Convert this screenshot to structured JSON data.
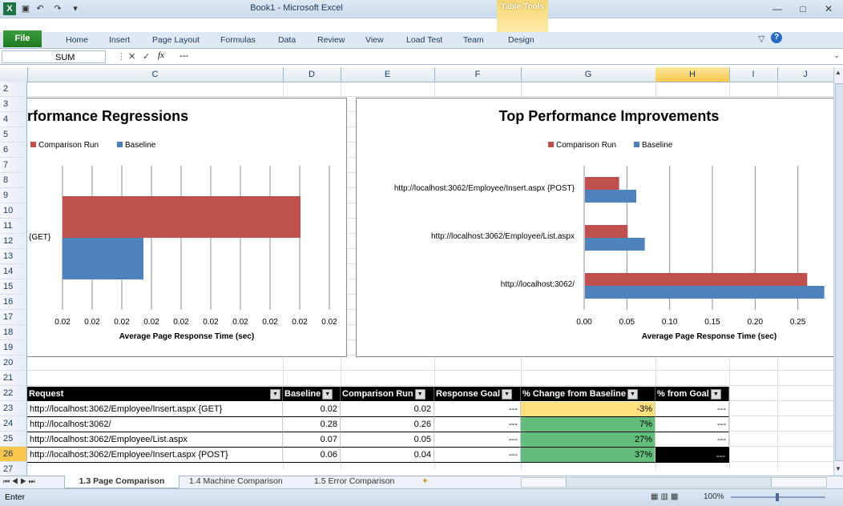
{
  "window": {
    "title": "Book1 - Microsoft Excel",
    "context_tab": "Table Tools"
  },
  "ribbon": {
    "file": "File",
    "tabs": [
      "Home",
      "Insert",
      "Page Layout",
      "Formulas",
      "Data",
      "Review",
      "View",
      "Load Test",
      "Team",
      "Design"
    ]
  },
  "formula_bar": {
    "name_box": "SUM",
    "fx": "fx",
    "content": "---"
  },
  "columns": [
    "C",
    "D",
    "E",
    "F",
    "G",
    "H",
    "I",
    "J"
  ],
  "rows": [
    "2",
    "3",
    "4",
    "5",
    "6",
    "7",
    "8",
    "9",
    "10",
    "11",
    "12",
    "13",
    "14",
    "15",
    "16",
    "17",
    "18",
    "19",
    "20",
    "21",
    "22",
    "23",
    "24",
    "25",
    "26",
    "27"
  ],
  "chart_left": {
    "title": "rformance Regressions",
    "legend": [
      "Comparison Run",
      "Baseline"
    ],
    "category": "{GET}",
    "xlabel": "Average Page Response Time (sec)",
    "ticks": [
      "0.02",
      "0.02",
      "0.02",
      "0.02",
      "0.02",
      "0.02",
      "0.02",
      "0.02",
      "0.02",
      "0.02"
    ]
  },
  "chart_data": {
    "type": "bar",
    "title": "Top Performance Improvements",
    "categories": [
      "http://localhost:3062/Employee/Insert.aspx {POST}",
      "http://localhost:3062/Employee/List.aspx",
      "http://localhost:3062/"
    ],
    "series": [
      {
        "name": "Comparison Run",
        "color": "#c0504d",
        "values": [
          0.04,
          0.05,
          0.26
        ]
      },
      {
        "name": "Baseline",
        "color": "#4f81bd",
        "values": [
          0.06,
          0.07,
          0.28
        ]
      }
    ],
    "xlabel": "Average Page Response Time (sec)",
    "xticks": [
      "0.00",
      "0.05",
      "0.10",
      "0.15",
      "0.20",
      "0.25"
    ],
    "xlim": [
      0,
      0.285
    ],
    "legend": "top",
    "grid": true
  },
  "table": {
    "headers": [
      "Request",
      "Baseline",
      "Comparison Run",
      "Response Goal",
      "% Change from Baseline",
      "% from Goal"
    ],
    "rows": [
      [
        "http://localhost:3062/Employee/Insert.aspx {GET}",
        "0.02",
        "0.02",
        "---",
        "-3%",
        "---"
      ],
      [
        "http://localhost:3062/",
        "0.28",
        "0.26",
        "---",
        "7%",
        "---"
      ],
      [
        "http://localhost:3062/Employee/List.aspx",
        "0.07",
        "0.05",
        "---",
        "27%",
        "---"
      ],
      [
        "http://localhost:3062/Employee/Insert.aspx {POST}",
        "0.06",
        "0.04",
        "---",
        "37%",
        "---"
      ]
    ],
    "change_colors": [
      "#ffe07f",
      "#63be7b",
      "#63be7b",
      "#63be7b"
    ]
  },
  "sheet_tabs": [
    "1.3 Page Comparison",
    "1.4 Machine Comparison",
    "1.5 Error Comparison"
  ],
  "status": {
    "mode": "Enter",
    "zoom": "100%"
  }
}
